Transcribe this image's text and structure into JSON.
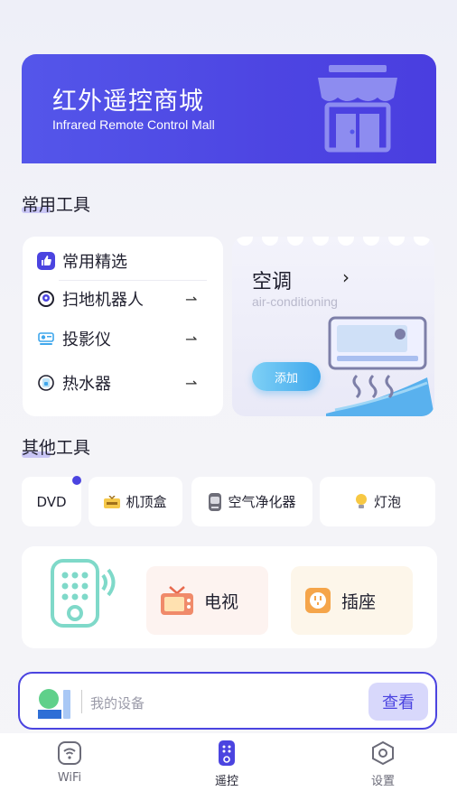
{
  "banner": {
    "title": "红外遥控商城",
    "subtitle": "Infrared Remote Control Mall"
  },
  "common_tools": {
    "title": "常用工具",
    "featured_label": "常用精选",
    "items": [
      {
        "label": "扫地机器人",
        "icon": "robot-vacuum-icon"
      },
      {
        "label": "投影仪",
        "icon": "projector-icon"
      },
      {
        "label": "热水器",
        "icon": "water-heater-icon"
      }
    ],
    "highlight": {
      "title": "空调",
      "subtitle": "air-conditioning",
      "button": "添加"
    }
  },
  "other_tools": {
    "title": "其他工具",
    "chips": [
      {
        "label": "DVD"
      },
      {
        "label": "机顶盒",
        "icon": "set-top-box-icon"
      },
      {
        "label": "空气净化器",
        "icon": "air-purifier-icon"
      },
      {
        "label": "灯泡",
        "icon": "bulb-icon"
      }
    ],
    "tiles": [
      {
        "label": "电视",
        "icon": "tv-icon",
        "bg": "#fdf3f0"
      },
      {
        "label": "插座",
        "icon": "socket-icon",
        "bg": "#fdf6ea"
      }
    ]
  },
  "devices": {
    "label": "我的设备",
    "view_button": "查看"
  },
  "nav": [
    {
      "label": "WiFi",
      "icon": "wifi-icon",
      "active": false
    },
    {
      "label": "遥控",
      "icon": "remote-icon",
      "active": true
    },
    {
      "label": "设置",
      "icon": "settings-icon",
      "active": false
    }
  ],
  "colors": {
    "primary": "#4b44e0",
    "banner": "#5456ea",
    "accent_blue": "#3fa7ec",
    "teal": "#7fd9c9"
  }
}
